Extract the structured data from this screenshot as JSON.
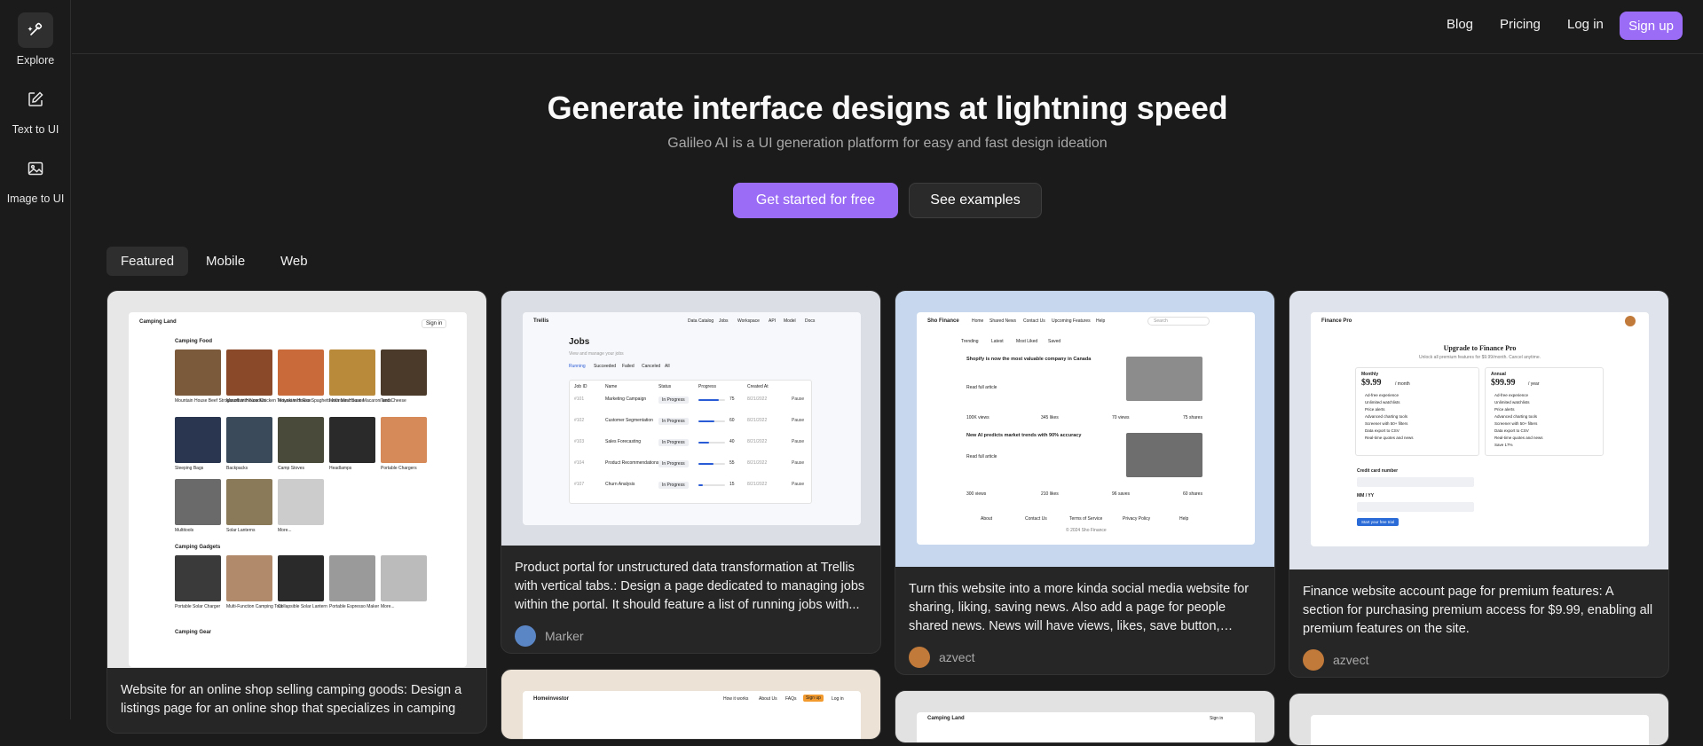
{
  "sidebar": {
    "items": [
      {
        "label": "Explore",
        "icon": "sparkle-brush-icon"
      },
      {
        "label": "Text to UI",
        "icon": "edit-square-icon"
      },
      {
        "label": "Image to UI",
        "icon": "image-icon"
      }
    ]
  },
  "nav": {
    "blog": "Blog",
    "pricing": "Pricing",
    "login": "Log in",
    "signup": "Sign up"
  },
  "hero": {
    "title": "Generate interface designs at lightning speed",
    "subtitle": "Galileo AI is a UI generation platform for easy and fast design ideation",
    "cta_primary": "Get started for free",
    "cta_secondary": "See examples"
  },
  "tabs": [
    "Featured",
    "Mobile",
    "Web"
  ],
  "cards": [
    {
      "description": "Website for an online shop selling camping goods: Design a listings page for an online shop that specializes in camping",
      "author": "",
      "preview": {
        "brand": "Camping Land",
        "signin": "Sign in",
        "section1": "Camping Food",
        "section2": "Camping Gadgets",
        "section3": "Camping Gear",
        "items": [
          "Mountain House Beef Stroganoff with Noodles",
          "Mountain House Chicken Teriyaki with Rice",
          "Mountain House Spaghetti with Meat Sauce",
          "Mountain House Macaroni and Cheese",
          "Tents",
          "Sleeping Bags",
          "Backpacks",
          "Camp Stoves",
          "Headlamps",
          "Portable Chargers",
          "Multitools",
          "Solar Lanterns",
          "More..."
        ],
        "gadgets": [
          "Portable Solar Charger",
          "Multi-Function Camping Tool",
          "Collapsible Solar Lantern",
          "Portable Espresso Maker",
          "More..."
        ]
      }
    },
    {
      "description": "Product portal for unstructured data transformation at Trellis with vertical tabs.: Design a page dedicated to managing jobs within the portal. It should feature a list of running jobs with...",
      "author": "Marker",
      "preview": {
        "brand": "Trellis",
        "nav": [
          "Data Catalog",
          "Jobs",
          "Workspace",
          "API",
          "Model",
          "Docs"
        ],
        "title": "Jobs",
        "subtitle": "View and manage your jobs",
        "tabs": [
          "Running",
          "Succeeded",
          "Failed",
          "Canceled",
          "All"
        ],
        "columns": [
          "Job ID",
          "Name",
          "Status",
          "Progress",
          "Created At"
        ],
        "rows": [
          {
            "id": "#101",
            "name": "Marketing Campaign",
            "status": "In Progress",
            "progress": 75,
            "date": "8/21/2022",
            "action": "Pause"
          },
          {
            "id": "#102",
            "name": "Customer Segmentation",
            "status": "In Progress",
            "progress": 60,
            "date": "8/21/2022",
            "action": "Pause"
          },
          {
            "id": "#103",
            "name": "Sales Forecasting",
            "status": "In Progress",
            "progress": 40,
            "date": "8/21/2022",
            "action": "Pause"
          },
          {
            "id": "#104",
            "name": "Product Recommendations",
            "status": "In Progress",
            "progress": 55,
            "date": "8/21/2022",
            "action": "Pause"
          },
          {
            "id": "#107",
            "name": "Churn Analysis",
            "status": "In Progress",
            "progress": 15,
            "date": "8/21/2022",
            "action": "Pause"
          }
        ]
      }
    },
    {
      "description": "Turn this website into a more kinda social media website for sharing, liking, saving news. Also add a page for people shared news. News will have views, likes, save button, sharing,...",
      "author": "azvect",
      "preview": {
        "brand": "Sho Finance",
        "nav": [
          "Home",
          "Shared News",
          "Contact Us",
          "Upcoming Features",
          "Help"
        ],
        "search": "Search",
        "chips": [
          "Trending",
          "Latest",
          "Most Liked",
          "Saved"
        ],
        "article1": "Shopify is now the most valuable company in Canada",
        "article2": "New AI predicts market trends with 90% accuracy",
        "read": "Read full article",
        "stats1": [
          "100K views",
          "345 likes",
          "70 views",
          "75 shares"
        ],
        "stats2": [
          "300 views",
          "210 likes",
          "96 saves",
          "60 shares"
        ],
        "footer": [
          "About",
          "Contact Us",
          "Terms of Service",
          "Privacy Policy",
          "Help"
        ],
        "copyright": "© 2024 Sho Finance"
      }
    },
    {
      "description": "Finance website account page for premium features: A section for purchasing premium access for $9.99, enabling all premium features on the site.",
      "author": "azvect",
      "preview": {
        "brand": "Finance Pro",
        "title": "Upgrade to Finance Pro",
        "subtitle": "Unlock all premium features for $9.99/month. Cancel anytime.",
        "monthly_label": "Monthly",
        "monthly_price": "$9.99",
        "monthly_unit": "/ month",
        "annual_label": "Annual",
        "annual_price": "$99.99",
        "annual_unit": "/ year",
        "features": [
          "Ad-free experience",
          "Unlimited watchlists",
          "Price alerts",
          "Advanced charting tools",
          "Screener with 50+ filters",
          "Data export to CSV",
          "Real-time quotes and news"
        ],
        "annual_extra": "Save 17%",
        "card_label": "Credit card number",
        "exp_label": "MM / YY",
        "button": "Start your free trial"
      }
    }
  ],
  "bottom_cards": [
    {
      "brand": "Homeinvestor",
      "nav": [
        "How it works",
        "About Us",
        "FAQs"
      ],
      "signup": "Sign up",
      "login": "Log in"
    },
    {
      "brand": "Camping Land",
      "signin": "Sign in"
    },
    {
      "brand": ""
    }
  ],
  "colors": {
    "accent": "#9b6cf5",
    "background": "#1b1b1b",
    "card": "#262626",
    "preview_blue": "#c7d8ee"
  }
}
